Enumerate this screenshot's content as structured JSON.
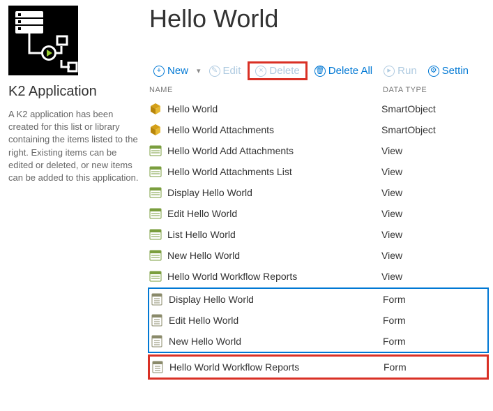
{
  "page_title": "Hello World",
  "sidebar": {
    "title": "K2 Application",
    "desc": "A K2 application has been created for this list or library containing the items listed to the right. Existing items can be edited or deleted, or new items can be added to this application."
  },
  "toolbar": {
    "new": "New",
    "edit": "Edit",
    "delete": "Delete",
    "delete_all": "Delete All",
    "run": "Run",
    "settings": "Settin"
  },
  "columns": {
    "name": "NAME",
    "type": "DATA TYPE"
  },
  "items": [
    {
      "icon": "cube",
      "name": "Hello World",
      "type": "SmartObject"
    },
    {
      "icon": "cube",
      "name": "Hello World Attachments",
      "type": "SmartObject"
    },
    {
      "icon": "view",
      "name": "Hello World Add Attachments",
      "type": "View"
    },
    {
      "icon": "view",
      "name": "Hello World Attachments List",
      "type": "View"
    },
    {
      "icon": "view",
      "name": "Display Hello World",
      "type": "View"
    },
    {
      "icon": "view",
      "name": "Edit Hello World",
      "type": "View"
    },
    {
      "icon": "view",
      "name": "List Hello World",
      "type": "View"
    },
    {
      "icon": "view",
      "name": "New Hello World",
      "type": "View"
    },
    {
      "icon": "view",
      "name": "Hello World Workflow Reports",
      "type": "View"
    }
  ],
  "group_blue": [
    {
      "icon": "form",
      "name": "Display Hello World",
      "type": "Form"
    },
    {
      "icon": "form",
      "name": "Edit Hello World",
      "type": "Form"
    },
    {
      "icon": "form",
      "name": "New Hello World",
      "type": "Form"
    }
  ],
  "group_red": [
    {
      "icon": "form",
      "name": "Hello World Workflow Reports",
      "type": "Form"
    }
  ]
}
